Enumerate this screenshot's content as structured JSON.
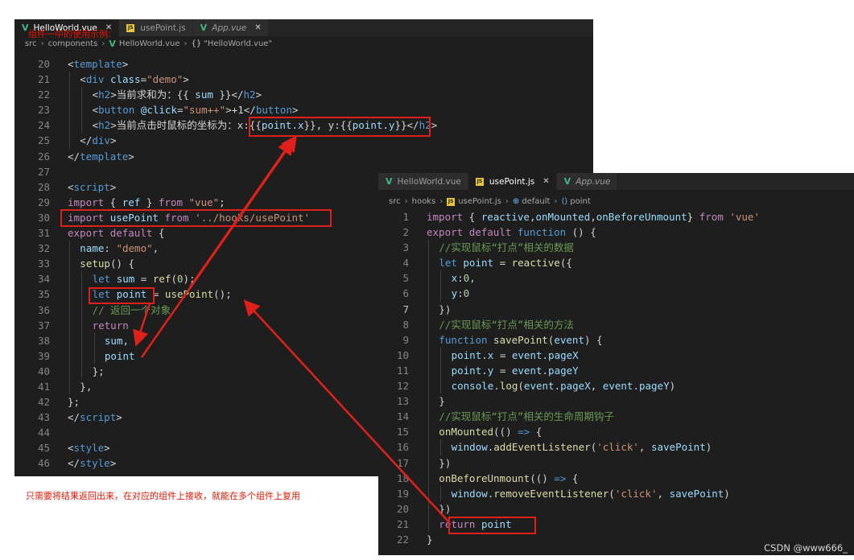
{
  "colors": {
    "tag": "#569cd6",
    "attr": "#9cdcfe",
    "string": "#ce9178",
    "keyword": "#c586c0",
    "storage": "#569cd6",
    "func": "#dcdcaa",
    "var": "#9cdcfe",
    "number": "#b5cea8",
    "comment": "#6a9955",
    "text": "#d4d4d4",
    "annotation": "#e51400"
  },
  "left_window": {
    "tabs": [
      {
        "label": "HelloWorld.vue",
        "icon": "vue-icon",
        "active": true,
        "close": "✕"
      },
      {
        "label": "usePoint.js",
        "icon": "js-icon",
        "active": false
      },
      {
        "label": "App.vue",
        "icon": "vue-icon",
        "active": false,
        "italic": true,
        "close": "✕"
      }
    ],
    "breadcrumb": [
      "src",
      "components",
      "HelloWorld.vue",
      "\"HelloWorld.vue\""
    ],
    "overlay_note": "组件一中的使用示例:",
    "lines": [
      {
        "n": "20",
        "indent": 0,
        "t": [
          [
            "&lt;",
            "text"
          ],
          [
            "template",
            "tag"
          ],
          [
            "&gt;",
            "text"
          ]
        ]
      },
      {
        "n": "21",
        "indent": 1,
        "t": [
          [
            "&lt;",
            "text"
          ],
          [
            "div ",
            "tag"
          ],
          [
            "class",
            "attr"
          ],
          [
            "=",
            "text"
          ],
          [
            "\"demo\"",
            "string"
          ],
          [
            "&gt;",
            "text"
          ]
        ]
      },
      {
        "n": "22",
        "indent": 2,
        "t": [
          [
            "&lt;",
            "text"
          ],
          [
            "h2",
            "tag"
          ],
          [
            "&gt;",
            "text"
          ],
          [
            "当前求和为：{{ ",
            "text"
          ],
          [
            "sum",
            "var"
          ],
          [
            " }}",
            "text"
          ],
          [
            "&lt;/",
            "text"
          ],
          [
            "h2",
            "tag"
          ],
          [
            "&gt;",
            "text"
          ]
        ]
      },
      {
        "n": "23",
        "indent": 2,
        "t": [
          [
            "&lt;",
            "text"
          ],
          [
            "button ",
            "tag"
          ],
          [
            "@click",
            "attr"
          ],
          [
            "=",
            "text"
          ],
          [
            "\"sum++\"",
            "string"
          ],
          [
            "&gt;+1&lt;/",
            "text"
          ],
          [
            "button",
            "tag"
          ],
          [
            "&gt;",
            "text"
          ]
        ]
      },
      {
        "n": "24",
        "indent": 2,
        "t": [
          [
            "&lt;",
            "text"
          ],
          [
            "h2",
            "tag"
          ],
          [
            "&gt;",
            "text"
          ],
          [
            "当前点击时鼠标的坐标为：x:{{",
            "text"
          ],
          [
            "point",
            "var"
          ],
          [
            ".",
            "text"
          ],
          [
            "x",
            "var"
          ],
          [
            "}}, y:{{",
            "text"
          ],
          [
            "point",
            "var"
          ],
          [
            ".",
            "text"
          ],
          [
            "y",
            "var"
          ],
          [
            "}}",
            "text"
          ],
          [
            "&lt;/",
            "text"
          ],
          [
            "h2",
            "tag"
          ],
          [
            "&gt;",
            "text"
          ]
        ]
      },
      {
        "n": "25",
        "indent": 1,
        "t": [
          [
            "&lt;/",
            "text"
          ],
          [
            "div",
            "tag"
          ],
          [
            "&gt;",
            "text"
          ]
        ]
      },
      {
        "n": "26",
        "indent": 0,
        "t": [
          [
            "&lt;/",
            "text"
          ],
          [
            "template",
            "tag"
          ],
          [
            "&gt;",
            "text"
          ]
        ]
      },
      {
        "n": "27",
        "indent": 0,
        "t": []
      },
      {
        "n": "28",
        "indent": 0,
        "t": [
          [
            "&lt;",
            "text"
          ],
          [
            "script",
            "tag"
          ],
          [
            "&gt;",
            "text"
          ]
        ]
      },
      {
        "n": "29",
        "indent": 0,
        "t": [
          [
            "import",
            "keyword"
          ],
          [
            " { ",
            "text"
          ],
          [
            "ref",
            "var"
          ],
          [
            " } ",
            "text"
          ],
          [
            "from",
            "keyword"
          ],
          [
            " ",
            "text"
          ],
          [
            "\"vue\"",
            "string"
          ],
          [
            ";",
            "text"
          ]
        ]
      },
      {
        "n": "30",
        "indent": 0,
        "t": [
          [
            "import",
            "keyword"
          ],
          [
            " ",
            "text"
          ],
          [
            "usePoint",
            "var"
          ],
          [
            " ",
            "text"
          ],
          [
            "from",
            "keyword"
          ],
          [
            " ",
            "text"
          ],
          [
            "'../hooks/usePoint'",
            "string"
          ]
        ]
      },
      {
        "n": "31",
        "indent": 0,
        "t": [
          [
            "export",
            "keyword"
          ],
          [
            " ",
            "text"
          ],
          [
            "default",
            "keyword"
          ],
          [
            " {",
            "text"
          ]
        ]
      },
      {
        "n": "32",
        "indent": 1,
        "t": [
          [
            "name",
            "var"
          ],
          [
            ": ",
            "text"
          ],
          [
            "\"demo\"",
            "string"
          ],
          [
            ",",
            "text"
          ]
        ]
      },
      {
        "n": "33",
        "indent": 1,
        "t": [
          [
            "setup",
            "func"
          ],
          [
            "() {",
            "text"
          ]
        ]
      },
      {
        "n": "34",
        "indent": 2,
        "t": [
          [
            "let",
            "storage"
          ],
          [
            " ",
            "text"
          ],
          [
            "sum",
            "var"
          ],
          [
            " = ",
            "text"
          ],
          [
            "ref",
            "func"
          ],
          [
            "(",
            "text"
          ],
          [
            "0",
            "number"
          ],
          [
            ");",
            "text"
          ]
        ]
      },
      {
        "n": "35",
        "indent": 2,
        "t": [
          [
            "let",
            "storage"
          ],
          [
            " ",
            "text"
          ],
          [
            "point",
            "var"
          ],
          [
            " = ",
            "text"
          ],
          [
            "usePoint",
            "func"
          ],
          [
            "();",
            "text"
          ]
        ]
      },
      {
        "n": "36",
        "indent": 2,
        "t": [
          [
            "// 返回一个对象",
            "comment"
          ]
        ]
      },
      {
        "n": "37",
        "indent": 2,
        "t": [
          [
            "return",
            "keyword"
          ]
        ]
      },
      {
        "n": "38",
        "indent": 3,
        "t": [
          [
            "sum",
            "var"
          ],
          [
            ",",
            "text"
          ]
        ]
      },
      {
        "n": "39",
        "indent": 3,
        "t": [
          [
            "point",
            "var"
          ]
        ]
      },
      {
        "n": "40",
        "indent": 2,
        "t": [
          [
            "};",
            "text"
          ]
        ]
      },
      {
        "n": "41",
        "indent": 1,
        "t": [
          [
            "},",
            "text"
          ]
        ]
      },
      {
        "n": "42",
        "indent": 0,
        "t": [
          [
            "};",
            "text"
          ]
        ]
      },
      {
        "n": "43",
        "indent": 0,
        "t": [
          [
            "&lt;/",
            "text"
          ],
          [
            "script",
            "tag"
          ],
          [
            "&gt;",
            "text"
          ]
        ]
      },
      {
        "n": "44",
        "indent": 0,
        "t": []
      },
      {
        "n": "45",
        "indent": 0,
        "t": [
          [
            "&lt;",
            "text"
          ],
          [
            "style",
            "tag"
          ],
          [
            "&gt;",
            "text"
          ]
        ]
      },
      {
        "n": "46",
        "indent": 0,
        "t": [
          [
            "&lt;/",
            "text"
          ],
          [
            "style",
            "tag"
          ],
          [
            "&gt;",
            "text"
          ]
        ]
      }
    ]
  },
  "right_window": {
    "tabs": [
      {
        "label": "HelloWorld.vue",
        "icon": "vue-icon",
        "active": false
      },
      {
        "label": "usePoint.js",
        "icon": "js-icon",
        "active": true,
        "close": "✕"
      },
      {
        "label": "App.vue",
        "icon": "vue-icon",
        "active": false,
        "italic": true
      }
    ],
    "breadcrumb": [
      "src",
      "hooks",
      "usePoint.js",
      "default",
      "point"
    ],
    "lines": [
      {
        "n": "1",
        "indent": 0,
        "t": [
          [
            "import",
            "keyword"
          ],
          [
            " { ",
            "text"
          ],
          [
            "reactive",
            "var"
          ],
          [
            ",",
            "text"
          ],
          [
            "onMounted",
            "var"
          ],
          [
            ",",
            "text"
          ],
          [
            "onBeforeUnmount",
            "var"
          ],
          [
            "} ",
            "text"
          ],
          [
            "from",
            "keyword"
          ],
          [
            " ",
            "text"
          ],
          [
            "'vue'",
            "string"
          ]
        ]
      },
      {
        "n": "2",
        "indent": 0,
        "t": [
          [
            "export",
            "keyword"
          ],
          [
            " ",
            "text"
          ],
          [
            "default",
            "keyword"
          ],
          [
            " ",
            "text"
          ],
          [
            "function",
            "storage"
          ],
          [
            " () {",
            "text"
          ]
        ]
      },
      {
        "n": "3",
        "indent": 1,
        "t": [
          [
            "//实现鼠标“打点”相关的数据",
            "comment"
          ]
        ]
      },
      {
        "n": "4",
        "indent": 1,
        "t": [
          [
            "let",
            "storage"
          ],
          [
            " ",
            "text"
          ],
          [
            "point",
            "var"
          ],
          [
            " = ",
            "text"
          ],
          [
            "reactive",
            "func"
          ],
          [
            "({",
            "text"
          ]
        ]
      },
      {
        "n": "5",
        "indent": 2,
        "t": [
          [
            "x",
            "var"
          ],
          [
            ":",
            "text"
          ],
          [
            "0",
            "number"
          ],
          [
            ",",
            "text"
          ]
        ]
      },
      {
        "n": "6",
        "indent": 2,
        "t": [
          [
            "y",
            "var"
          ],
          [
            ":",
            "text"
          ],
          [
            "0",
            "number"
          ]
        ]
      },
      {
        "n": "7",
        "indent": 1,
        "cur": true,
        "t": [
          [
            "})",
            "text"
          ]
        ]
      },
      {
        "n": "8",
        "indent": 1,
        "t": [
          [
            "//实现鼠标“打点”相关的方法",
            "comment"
          ]
        ]
      },
      {
        "n": "9",
        "indent": 1,
        "t": [
          [
            "function",
            "storage"
          ],
          [
            " ",
            "text"
          ],
          [
            "savePoint",
            "func"
          ],
          [
            "(",
            "text"
          ],
          [
            "event",
            "var"
          ],
          [
            ") {",
            "text"
          ]
        ]
      },
      {
        "n": "10",
        "indent": 2,
        "t": [
          [
            "point",
            "var"
          ],
          [
            ".",
            "text"
          ],
          [
            "x",
            "var"
          ],
          [
            " = ",
            "text"
          ],
          [
            "event",
            "var"
          ],
          [
            ".",
            "text"
          ],
          [
            "pageX",
            "var"
          ]
        ]
      },
      {
        "n": "11",
        "indent": 2,
        "t": [
          [
            "point",
            "var"
          ],
          [
            ".",
            "text"
          ],
          [
            "y",
            "var"
          ],
          [
            " = ",
            "text"
          ],
          [
            "event",
            "var"
          ],
          [
            ".",
            "text"
          ],
          [
            "pageY",
            "var"
          ]
        ]
      },
      {
        "n": "12",
        "indent": 2,
        "t": [
          [
            "console",
            "var"
          ],
          [
            ".",
            "text"
          ],
          [
            "log",
            "func"
          ],
          [
            "(",
            "text"
          ],
          [
            "event",
            "var"
          ],
          [
            ".",
            "text"
          ],
          [
            "pageX",
            "var"
          ],
          [
            ", ",
            "text"
          ],
          [
            "event",
            "var"
          ],
          [
            ".",
            "text"
          ],
          [
            "pageY",
            "var"
          ],
          [
            ")",
            "text"
          ]
        ]
      },
      {
        "n": "13",
        "indent": 1,
        "t": [
          [
            "}",
            "text"
          ]
        ]
      },
      {
        "n": "14",
        "indent": 1,
        "t": [
          [
            "//实现鼠标“打点”相关的生命周期钩子",
            "comment"
          ]
        ]
      },
      {
        "n": "15",
        "indent": 1,
        "t": [
          [
            "onMounted",
            "func"
          ],
          [
            "(() ",
            "text"
          ],
          [
            "=>",
            "storage"
          ],
          [
            " {",
            "text"
          ]
        ]
      },
      {
        "n": "16",
        "indent": 2,
        "t": [
          [
            "window",
            "var"
          ],
          [
            ".",
            "text"
          ],
          [
            "addEventListener",
            "func"
          ],
          [
            "(",
            "text"
          ],
          [
            "'click'",
            "string"
          ],
          [
            ", ",
            "text"
          ],
          [
            "savePoint",
            "var"
          ],
          [
            ")",
            "text"
          ]
        ]
      },
      {
        "n": "17",
        "indent": 1,
        "t": [
          [
            "})",
            "text"
          ]
        ]
      },
      {
        "n": "18",
        "indent": 1,
        "t": [
          [
            "onBeforeUnmount",
            "func"
          ],
          [
            "(() ",
            "text"
          ],
          [
            "=>",
            "storage"
          ],
          [
            " {",
            "text"
          ]
        ]
      },
      {
        "n": "19",
        "indent": 2,
        "t": [
          [
            "window",
            "var"
          ],
          [
            ".",
            "text"
          ],
          [
            "removeEventListener",
            "func"
          ],
          [
            "(",
            "text"
          ],
          [
            "'click'",
            "string"
          ],
          [
            ", ",
            "text"
          ],
          [
            "savePoint",
            "var"
          ],
          [
            ")",
            "text"
          ]
        ]
      },
      {
        "n": "20",
        "indent": 1,
        "t": [
          [
            "})",
            "text"
          ]
        ]
      },
      {
        "n": "21",
        "indent": 1,
        "t": [
          [
            "return",
            "keyword"
          ],
          [
            " ",
            "text"
          ],
          [
            "point",
            "var"
          ]
        ]
      },
      {
        "n": "22",
        "indent": 0,
        "t": [
          [
            "}",
            "text"
          ]
        ]
      }
    ]
  },
  "bottom_note": "只需要将结果返回出来，在对应的组件上接收，就能在多个组件上复用",
  "watermark": "CSDN @www666_"
}
